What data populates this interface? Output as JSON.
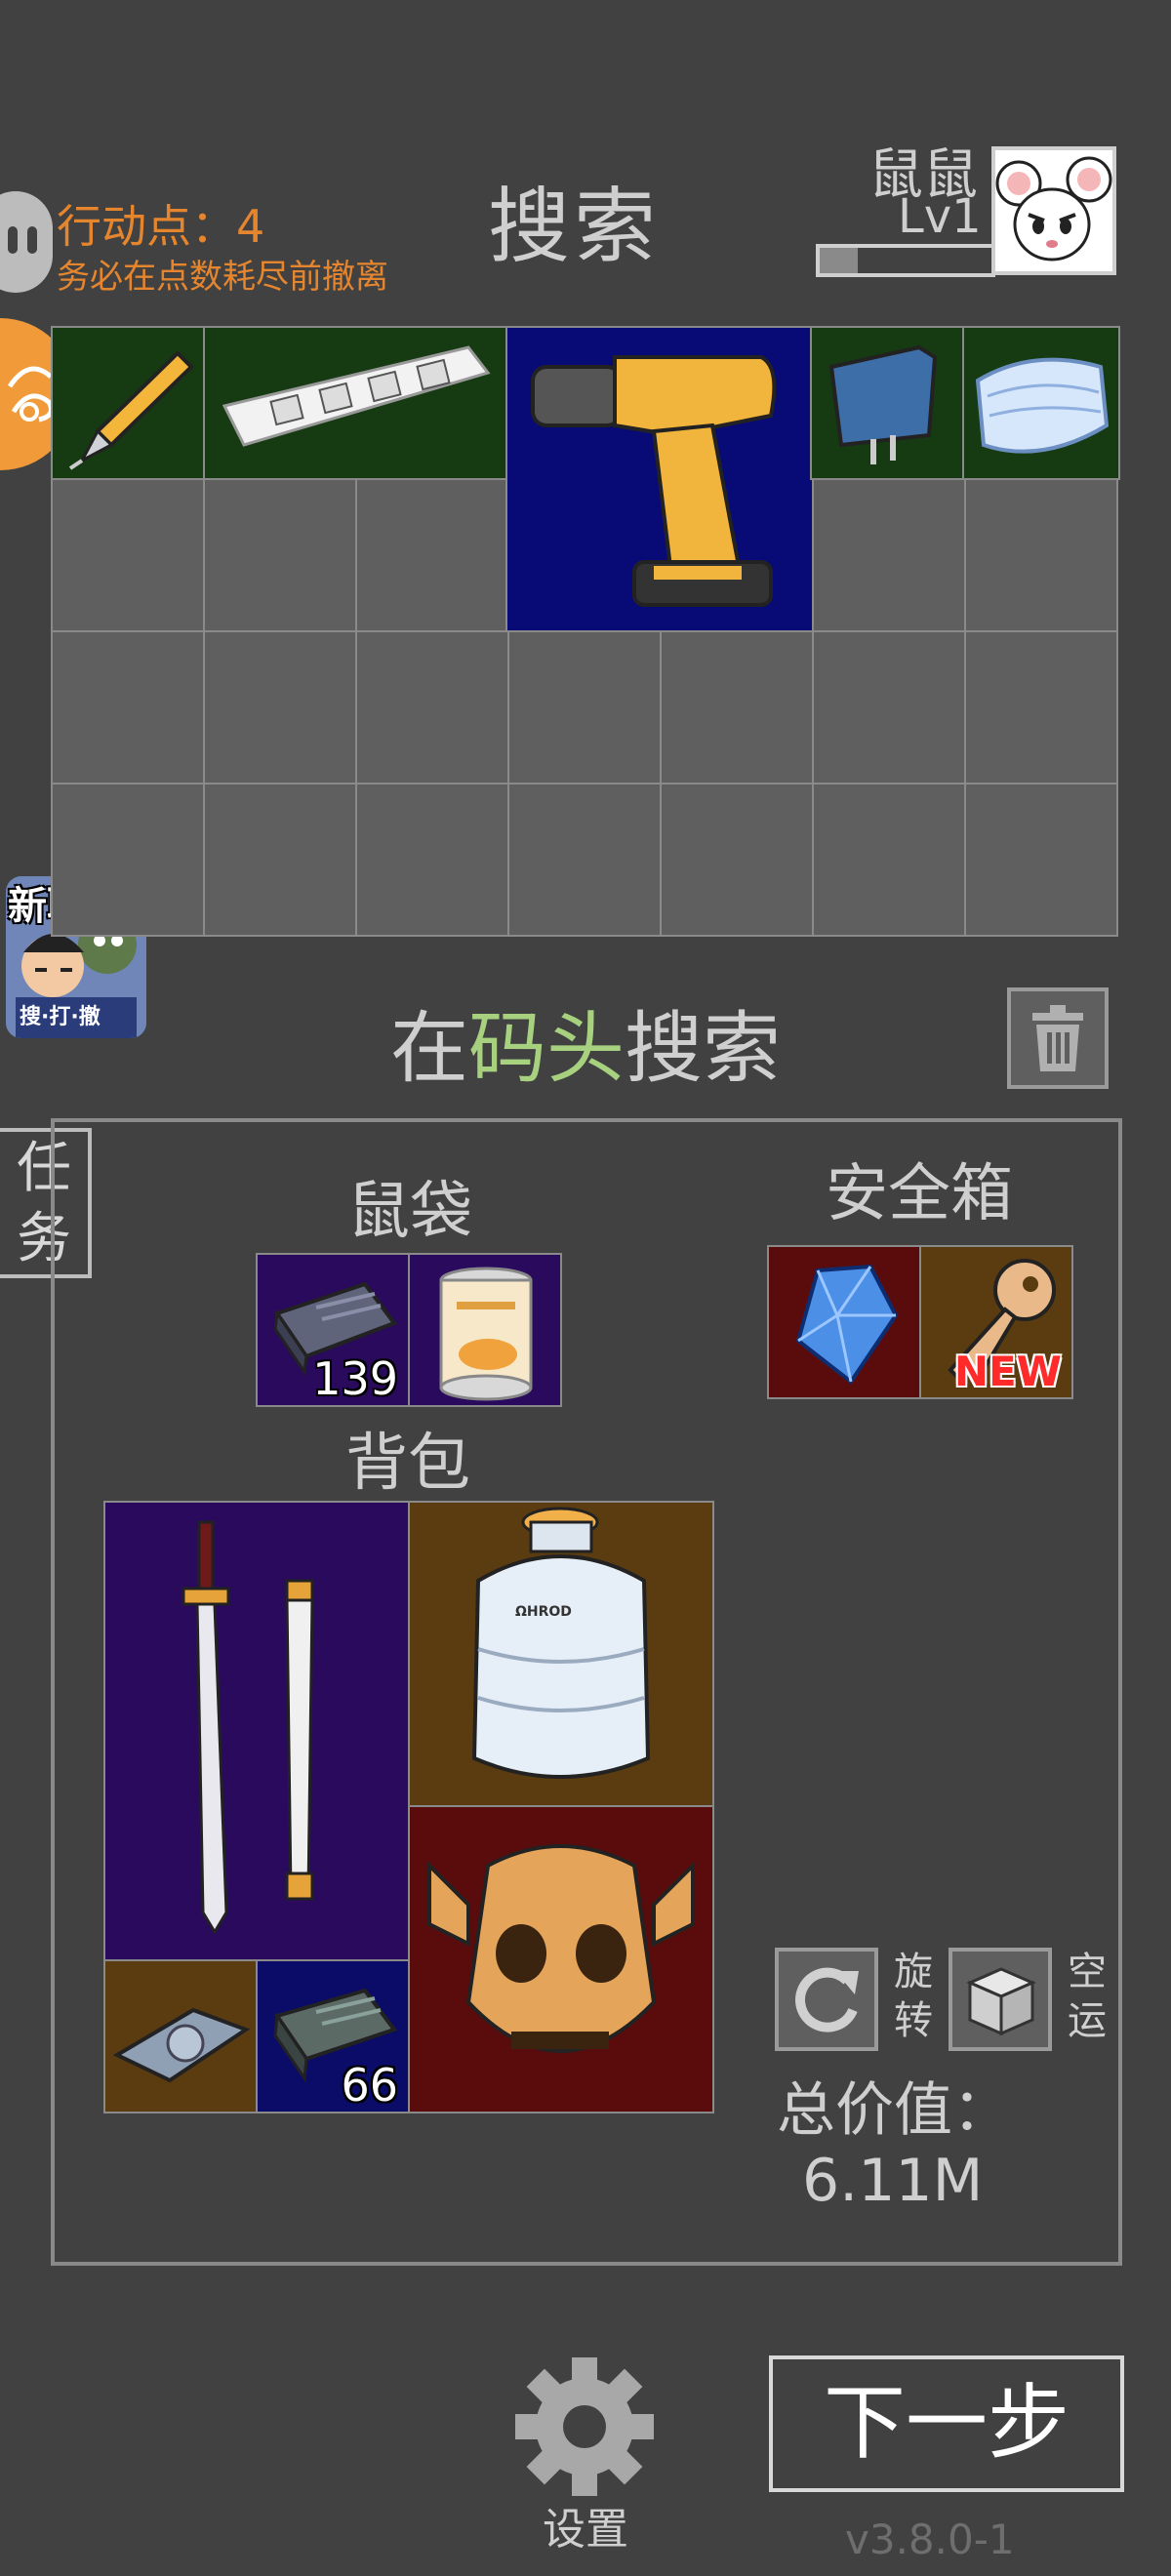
{
  "header": {
    "action_points_label": "行动点：4",
    "action_points_hint": "务必在点数耗尽前撤离",
    "title": "搜索",
    "player_name": "鼠鼠",
    "player_level": "Lv1",
    "xp_fraction": 0.22
  },
  "side": {
    "collab_title": "新联动",
    "collab_subtitle": "搜·打·撤",
    "task_label_1": "任",
    "task_label_2": "务"
  },
  "search_grid": {
    "items": [
      {
        "name": "voltage-tester-pen",
        "bg": "green"
      },
      {
        "name": "power-strip",
        "bg": "green"
      },
      {
        "name": "cordless-drill",
        "bg": "navy"
      },
      {
        "name": "power-adapter",
        "bg": "green"
      },
      {
        "name": "face-mask",
        "bg": "green"
      }
    ]
  },
  "location": {
    "prefix": "在",
    "place": "码头",
    "suffix": "搜索"
  },
  "pouch": {
    "label": "鼠袋",
    "items": [
      {
        "name": "ammo-box",
        "count": "139"
      },
      {
        "name": "canned-peaches"
      }
    ]
  },
  "safe_box": {
    "label": "安全箱",
    "items": [
      {
        "name": "blue-gem"
      },
      {
        "name": "key",
        "badge": "NEW"
      }
    ]
  },
  "backpack": {
    "label": "背包",
    "items": [
      {
        "name": "katana-sword"
      },
      {
        "name": "liquid-nitrogen-tank",
        "tank_text": "ΩHROD"
      },
      {
        "name": "tribal-mask"
      },
      {
        "name": "hard-disk"
      },
      {
        "name": "ammo-box",
        "count": "66"
      }
    ]
  },
  "controls": {
    "rotate_label": "旋转",
    "airship_label": "空运",
    "total_label": "总价值：",
    "total_value": "6.11M"
  },
  "footer": {
    "settings_label": "设置",
    "next_label": "下一步",
    "version": "v3.8.0-1"
  }
}
